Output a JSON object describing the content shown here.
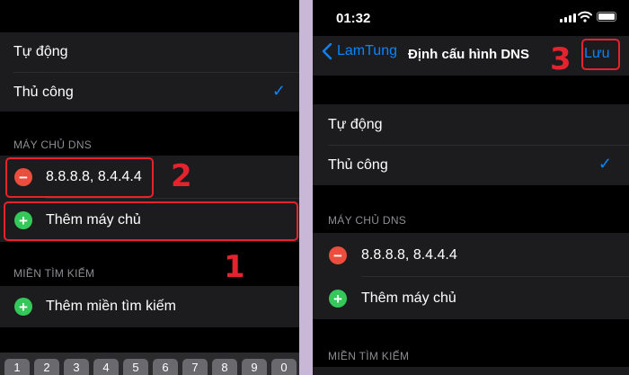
{
  "left_panel": {
    "mode_options": [
      {
        "label": "Tự động"
      },
      {
        "label": "Thủ công",
        "selected": true
      }
    ],
    "dns_section_title": "MÁY CHỦ DNS",
    "dns_server_value": "8.8.8.8, 8.4.4.4",
    "add_server_label": "Thêm máy chủ",
    "search_section_title": "MIỀN TÌM KIẾM",
    "add_search_domain_label": "Thêm miền tìm kiếm",
    "keyboard_keys": [
      "1",
      "2",
      "3",
      "4",
      "5",
      "6",
      "7",
      "8",
      "9",
      "0"
    ],
    "annotations": {
      "step_1": "1",
      "step_2": "2"
    }
  },
  "right_panel": {
    "status_time": "01:32",
    "nav_back_label": "LamTung",
    "nav_title": "Định cấu hình DNS",
    "nav_save_label": "Lưu",
    "mode_options": [
      {
        "label": "Tự động"
      },
      {
        "label": "Thủ công",
        "selected": true
      }
    ],
    "dns_section_title": "MÁY CHỦ DNS",
    "dns_server_value": "8.8.8.8, 8.4.4.4",
    "add_server_label": "Thêm máy chủ",
    "search_section_title": "MIỀN TÌM KIẾM",
    "annotations": {
      "step_3": "3"
    }
  },
  "colors": {
    "accent_blue": "#0a84ff",
    "annotation_red": "#e3232d",
    "delete_red": "#eb4e3d",
    "add_green": "#34c759"
  }
}
